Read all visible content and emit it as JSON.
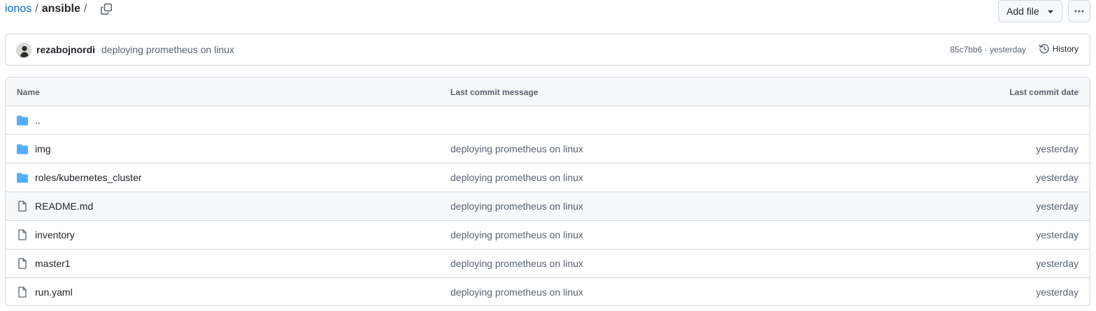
{
  "breadcrumb": {
    "owner": "ionos",
    "separator": "/",
    "repo": "ansible",
    "trailing_separator": "/"
  },
  "actions": {
    "add_file_label": "Add file",
    "more_icon": "kebab-horizontal-icon",
    "copy_icon": "copy-path-icon"
  },
  "latest_commit": {
    "author": "rezabojnordi",
    "message": "deploying prometheus on linux",
    "sha": "85c7bb6",
    "separator": "·",
    "time": "yesterday",
    "history_label": "History"
  },
  "table": {
    "headers": {
      "name": "Name",
      "message": "Last commit message",
      "date": "Last commit date"
    },
    "rows": [
      {
        "type": "folder",
        "name": "..",
        "message": "",
        "date": ""
      },
      {
        "type": "folder",
        "name": "img",
        "message": "deploying prometheus on linux",
        "date": "yesterday"
      },
      {
        "type": "folder",
        "name": "roles/kubernetes_cluster",
        "message": "deploying prometheus on linux",
        "date": "yesterday"
      },
      {
        "type": "file",
        "name": "README.md",
        "message": "deploying prometheus on linux",
        "date": "yesterday"
      },
      {
        "type": "file",
        "name": "inventory",
        "message": "deploying prometheus on linux",
        "date": "yesterday"
      },
      {
        "type": "file",
        "name": "master1",
        "message": "deploying prometheus on linux",
        "date": "yesterday"
      },
      {
        "type": "file",
        "name": "run.yaml",
        "message": "deploying prometheus on linux",
        "date": "yesterday"
      }
    ]
  },
  "colors": {
    "link": "#0969da",
    "folder": "#54aeff",
    "muted": "#59636e",
    "border": "#d1d9e0",
    "header_bg": "#f6f8fa"
  }
}
